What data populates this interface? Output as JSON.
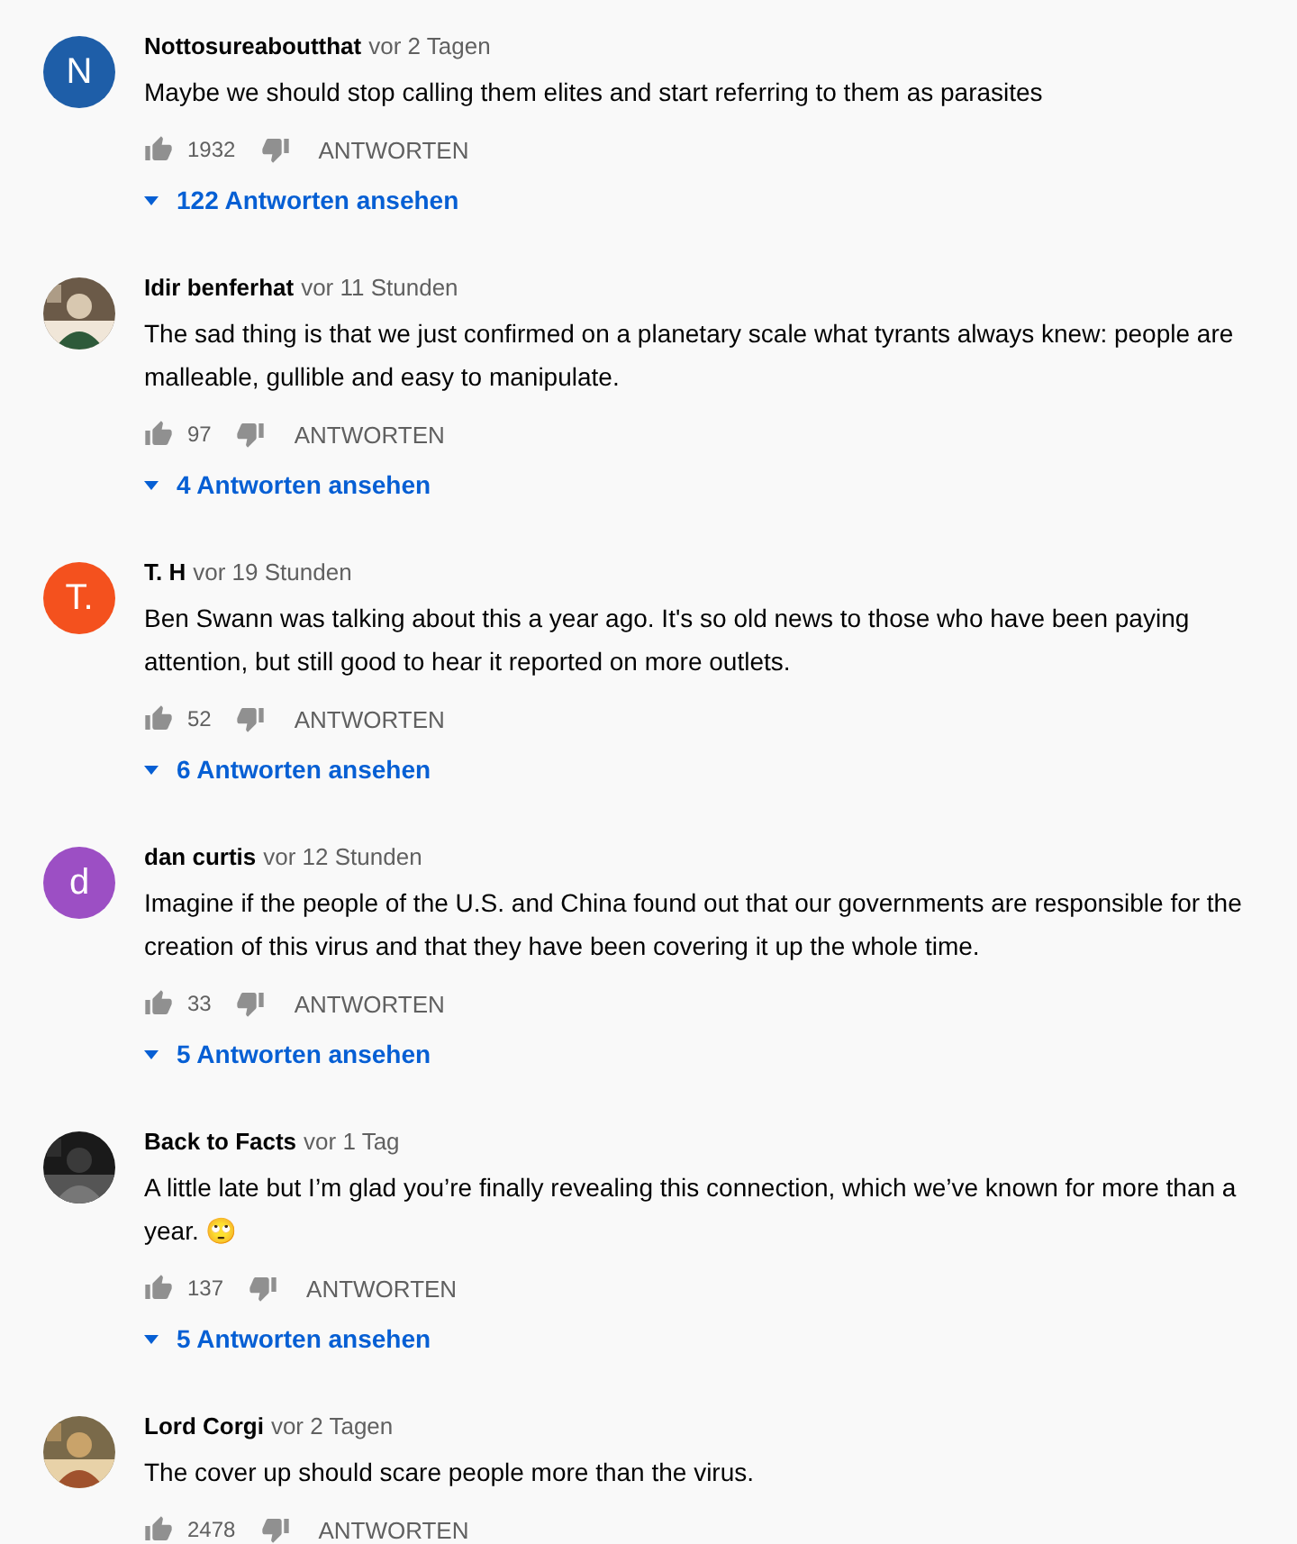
{
  "comments": [
    {
      "author": "Nottosureaboutthat",
      "time": "vor 2 Tagen",
      "avatar": {
        "kind": "letter",
        "letter": "N",
        "color": "#1e5ea8"
      },
      "text": "Maybe we should stop calling them elites and start referring to them as parasites",
      "likes": "1932",
      "reply_label": "ANTWORTEN",
      "replies": "122 Antworten ansehen"
    },
    {
      "author": "Idir benferhat",
      "time": "vor 11 Stunden",
      "text": "The sad thing is that we just confirmed on a planetary scale what tyrants always knew: people are malleable, gullible and easy to manipulate.",
      "likes": "97",
      "reply_label": "ANTWORTEN",
      "replies": "4 Antworten ansehen"
    },
    {
      "author": "T. H",
      "time": "vor 19 Stunden",
      "avatar": {
        "kind": "letter",
        "letter": "T.",
        "color": "#f4511e"
      },
      "text": "Ben Swann was talking about this a year ago. It's so old news to those who have been paying attention, but still good to hear it reported on more outlets.",
      "likes": "52",
      "reply_label": "ANTWORTEN",
      "replies": "6 Antworten ansehen"
    },
    {
      "author": "dan curtis",
      "time": "vor 12 Stunden",
      "avatar": {
        "kind": "letter",
        "letter": "d",
        "color": "#9c4fc4"
      },
      "text": "Imagine if the people of the U.S. and China found out that our governments are responsible for the creation of this virus and that they have been covering it up the whole time.",
      "likes": "33",
      "reply_label": "ANTWORTEN",
      "replies": "5 Antworten ansehen"
    },
    {
      "author": "Back to Facts",
      "time": "vor 1 Tag",
      "text": "A little late but I’m glad you’re finally revealing this connection, which we’ve known for more than a year. 🙄",
      "likes": "137",
      "reply_label": "ANTWORTEN",
      "replies": "5 Antworten ansehen"
    },
    {
      "author": "Lord Corgi",
      "time": "vor 2 Tagen",
      "text": "The cover up should scare people more than the virus.",
      "likes": "2478",
      "reply_label": "ANTWORTEN"
    }
  ]
}
